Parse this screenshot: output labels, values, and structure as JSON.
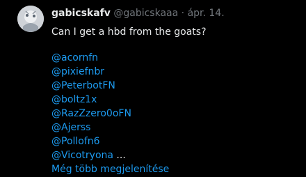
{
  "tweet": {
    "display_name": "gabicskafv",
    "handle": "@gabicskaaa",
    "separator": "·",
    "date": "ápr. 14.",
    "text": "Can I get a hbd from the goats?",
    "mentions": [
      {
        "label": "@acornfn"
      },
      {
        "label": "@pixiefnbr"
      },
      {
        "label": "@PeterbotFN"
      },
      {
        "label": "@boltz1x"
      },
      {
        "label": "@RazZzero0oFN"
      },
      {
        "label": "@Ajerss"
      },
      {
        "label": "@Pollofn6"
      },
      {
        "label": "@Vicotryona"
      }
    ],
    "ellipsis": " ...",
    "show_more": "Még több megjelenítése"
  },
  "colors": {
    "background": "#000000",
    "text": "#e7e9ea",
    "muted": "#71767b",
    "link": "#1d9bf0"
  },
  "icons": {
    "avatar": "profile-avatar"
  }
}
